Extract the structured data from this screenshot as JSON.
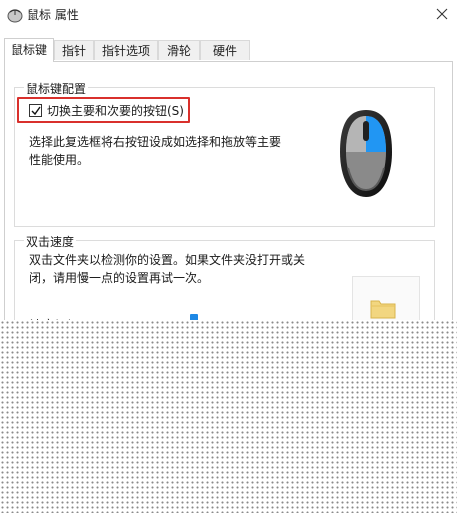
{
  "window": {
    "title": "鼠标 属性",
    "icon": "mouse-icon",
    "close_icon": "close-icon"
  },
  "tabs": [
    {
      "label": "鼠标键",
      "active": true
    },
    {
      "label": "指针",
      "active": false
    },
    {
      "label": "指针选项",
      "active": false
    },
    {
      "label": "滑轮",
      "active": false
    },
    {
      "label": "硬件",
      "active": false
    }
  ],
  "button_config": {
    "title": "鼠标键配置",
    "checkbox_label": "切换主要和次要的按钮(S)",
    "checkbox_checked": true,
    "description_line1": "选择此复选框将右按钮设成如选择和拖放等主要",
    "description_line2": "性能使用。",
    "highlight_color": "#d9302c",
    "mouse_accent_color": "#2196f3"
  },
  "double_click": {
    "title": "双击速度",
    "description_line1": "双击文件夹以检测你的设置。如果文件夹没打开或关",
    "description_line2": "闭，请用慢一点的设置再试一次。",
    "speed_label": "速度(D)",
    "folder_icon": "folder-icon",
    "slider_color": "#1e88e5"
  }
}
